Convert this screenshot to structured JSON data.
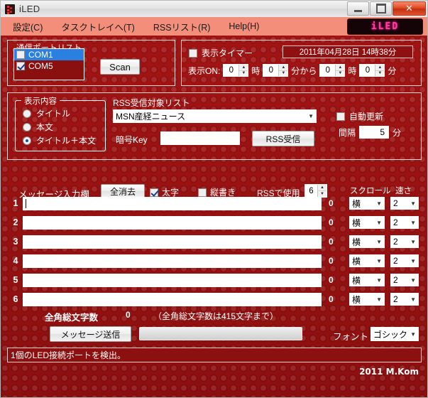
{
  "window": {
    "title": "iLED",
    "icon": "iled-app-icon",
    "minimize_label": "",
    "maximize_label": "",
    "close_label": "✕"
  },
  "menu": {
    "items": [
      {
        "label": "設定(C)",
        "name": "menu-settings"
      },
      {
        "label": "タスクトレイへ(T)",
        "name": "menu-tasktray"
      },
      {
        "label": "RSSリスト(R)",
        "name": "menu-rss-list"
      },
      {
        "label": "Help(H)",
        "name": "menu-help"
      }
    ],
    "logo_text": "iLED"
  },
  "port_panel": {
    "legend": "通信ポートリスト",
    "ports": [
      {
        "label": "COM1",
        "checked": false,
        "selected": true
      },
      {
        "label": "COM5",
        "checked": true,
        "selected": false
      }
    ],
    "scan_label": "Scan"
  },
  "timer_panel": {
    "timer_checkbox_label": "表示タイマー",
    "timer_checked": false,
    "datetime": "2011年04月28日  14時38分",
    "display_on_label": "表示ON:",
    "from_hour": "0",
    "hour_unit": "時",
    "from_minute": "0",
    "minute_unit_from": "分から",
    "to_hour": "0",
    "hour_unit2": "時",
    "to_minute": "0",
    "minute_unit_to": "分"
  },
  "content_panel": {
    "legend": "表示内容",
    "options": [
      {
        "label": "タイトル",
        "selected": false
      },
      {
        "label": "本文",
        "selected": false
      },
      {
        "label": "タイトル＋本文",
        "selected": true
      }
    ]
  },
  "rss_panel": {
    "list_label": "RSS受信対象リスト",
    "selected_feed": "MSN産経ニュース",
    "key_label": "暗号Key",
    "key_value": "",
    "receive_button": "RSS受信",
    "auto_update_label": "自動更新",
    "auto_update_checked": false,
    "interval_label": "間隔",
    "interval_value": "5",
    "interval_unit": "分"
  },
  "message_panel": {
    "input_area_label": "メッセージ入力欄",
    "clear_all_label": "全消去",
    "bold_label": "太字",
    "bold_checked": true,
    "vertical_label": "縦書き",
    "vertical_checked": false,
    "rss_use_label": "RSSで使用",
    "rss_use_value": "6",
    "scroll_header": "スクロール",
    "speed_header": "速さ",
    "rows": [
      {
        "num": "1",
        "text": "",
        "count": "0",
        "scroll": "横",
        "speed": "2",
        "focused": true
      },
      {
        "num": "2",
        "text": "",
        "count": "0",
        "scroll": "横",
        "speed": "2",
        "focused": false
      },
      {
        "num": "3",
        "text": "",
        "count": "0",
        "scroll": "横",
        "speed": "2",
        "focused": false
      },
      {
        "num": "4",
        "text": "",
        "count": "0",
        "scroll": "横",
        "speed": "2",
        "focused": false
      },
      {
        "num": "5",
        "text": "",
        "count": "0",
        "scroll": "横",
        "speed": "2",
        "focused": false
      },
      {
        "num": "6",
        "text": "",
        "count": "0",
        "scroll": "横",
        "speed": "2",
        "focused": false
      }
    ],
    "total_label": "全角総文字数",
    "total_value": "0",
    "total_note": "（全角総文字数は415文字まで）"
  },
  "footer": {
    "send_label": "メッセージ送信",
    "progress_percent": "0",
    "font_label": "フォント",
    "font_value": "ゴシック"
  },
  "statusbar": {
    "text": "1個のLED接続ポートを検出。",
    "copyright": "2011 M.Kom"
  },
  "colors": {
    "body_red": "#9e1212",
    "menu_salmon": "#f28e7a",
    "accent_pink": "#ff3fa0",
    "select_blue": "#2a7fe0"
  }
}
